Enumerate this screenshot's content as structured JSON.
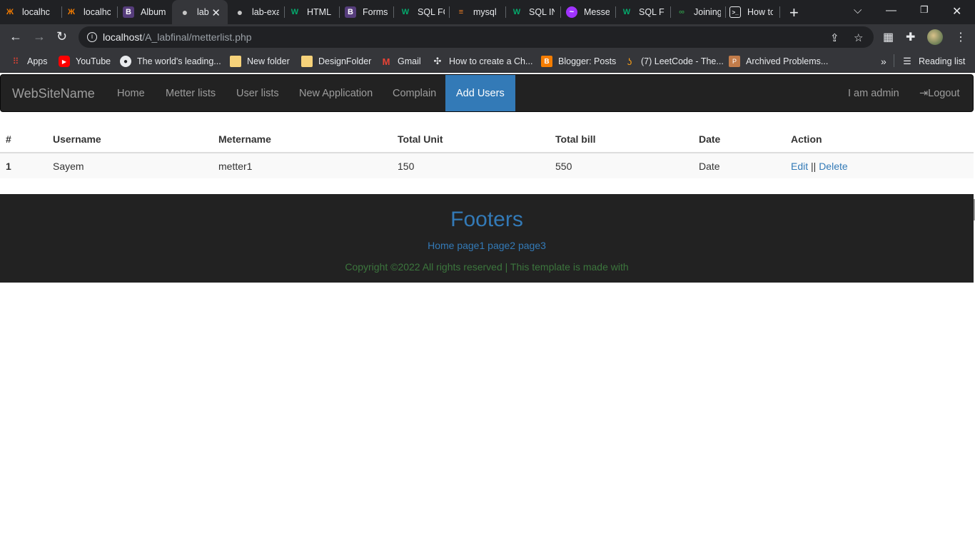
{
  "browser": {
    "tabs": [
      {
        "label": "localhc",
        "icon": "xampp-icon"
      },
      {
        "label": "localhc",
        "icon": "xampp-icon"
      },
      {
        "label": "Album",
        "icon": "bootstrap-icon"
      },
      {
        "label": "lab",
        "icon": "globe-icon",
        "active": true
      },
      {
        "label": "lab-exa",
        "icon": "globe-icon"
      },
      {
        "label": "HTML",
        "icon": "w3schools-icon"
      },
      {
        "label": "Forms",
        "icon": "bootstrap-icon"
      },
      {
        "label": "SQL FC",
        "icon": "w3schools-icon"
      },
      {
        "label": "mysql",
        "icon": "stackoverflow-icon"
      },
      {
        "label": "SQL IN",
        "icon": "w3schools-icon"
      },
      {
        "label": "Messe",
        "icon": "messenger-icon"
      },
      {
        "label": "SQL FU",
        "icon": "w3schools-icon"
      },
      {
        "label": "Joining",
        "icon": "geeksforgeeks-icon"
      },
      {
        "label": "How to",
        "icon": "terminal-icon"
      }
    ],
    "url_host": "localhost",
    "url_path": "/A_labfinal/metterlist.php",
    "bookmarks": [
      {
        "label": "Apps",
        "icon": "apps-grid-icon"
      },
      {
        "label": "YouTube",
        "icon": "youtube-icon"
      },
      {
        "label": "The world's leading...",
        "icon": "github-icon"
      },
      {
        "label": "New folder",
        "icon": "folder-icon"
      },
      {
        "label": "DesignFolder",
        "icon": "folder-icon"
      },
      {
        "label": "Gmail",
        "icon": "gmail-icon"
      },
      {
        "label": "How to create a Ch...",
        "icon": "chatgpt-icon"
      },
      {
        "label": "Blogger: Posts",
        "icon": "blogger-icon"
      },
      {
        "label": "(7) LeetCode - The...",
        "icon": "leetcode-icon"
      },
      {
        "label": "Archived Problems...",
        "icon": "archive-icon"
      }
    ],
    "more_bookmarks": "»",
    "reading_list": "Reading list"
  },
  "navbar": {
    "brand": "WebSiteName",
    "links": [
      "Home",
      "Metter lists",
      "User lists",
      "New Application",
      "Complain",
      "Add Users"
    ],
    "active": "Add Users",
    "user_label": "I am admin",
    "logout_label": "Logout"
  },
  "table": {
    "headers": [
      "#",
      "Username",
      "Metername",
      "Total Unit",
      "Total bill",
      "Date",
      "Action"
    ],
    "rows": [
      {
        "index": "1",
        "username": "Sayem",
        "metername": "metter1",
        "total_unit": "150",
        "total_bill": "550",
        "date": "Date",
        "edit": "Edit",
        "separator": "||",
        "delete": "Delete"
      }
    ]
  },
  "footer": {
    "title": "Footers",
    "links": [
      "Home",
      "page1",
      "page2",
      "page3"
    ],
    "copyright": "Copyright ©2022 All rights reserved | This template is made with"
  },
  "colors": {
    "navbar_bg": "#222222",
    "active_link_bg": "#337ab7",
    "link": "#337ab7",
    "copyright": "#3c763d"
  }
}
